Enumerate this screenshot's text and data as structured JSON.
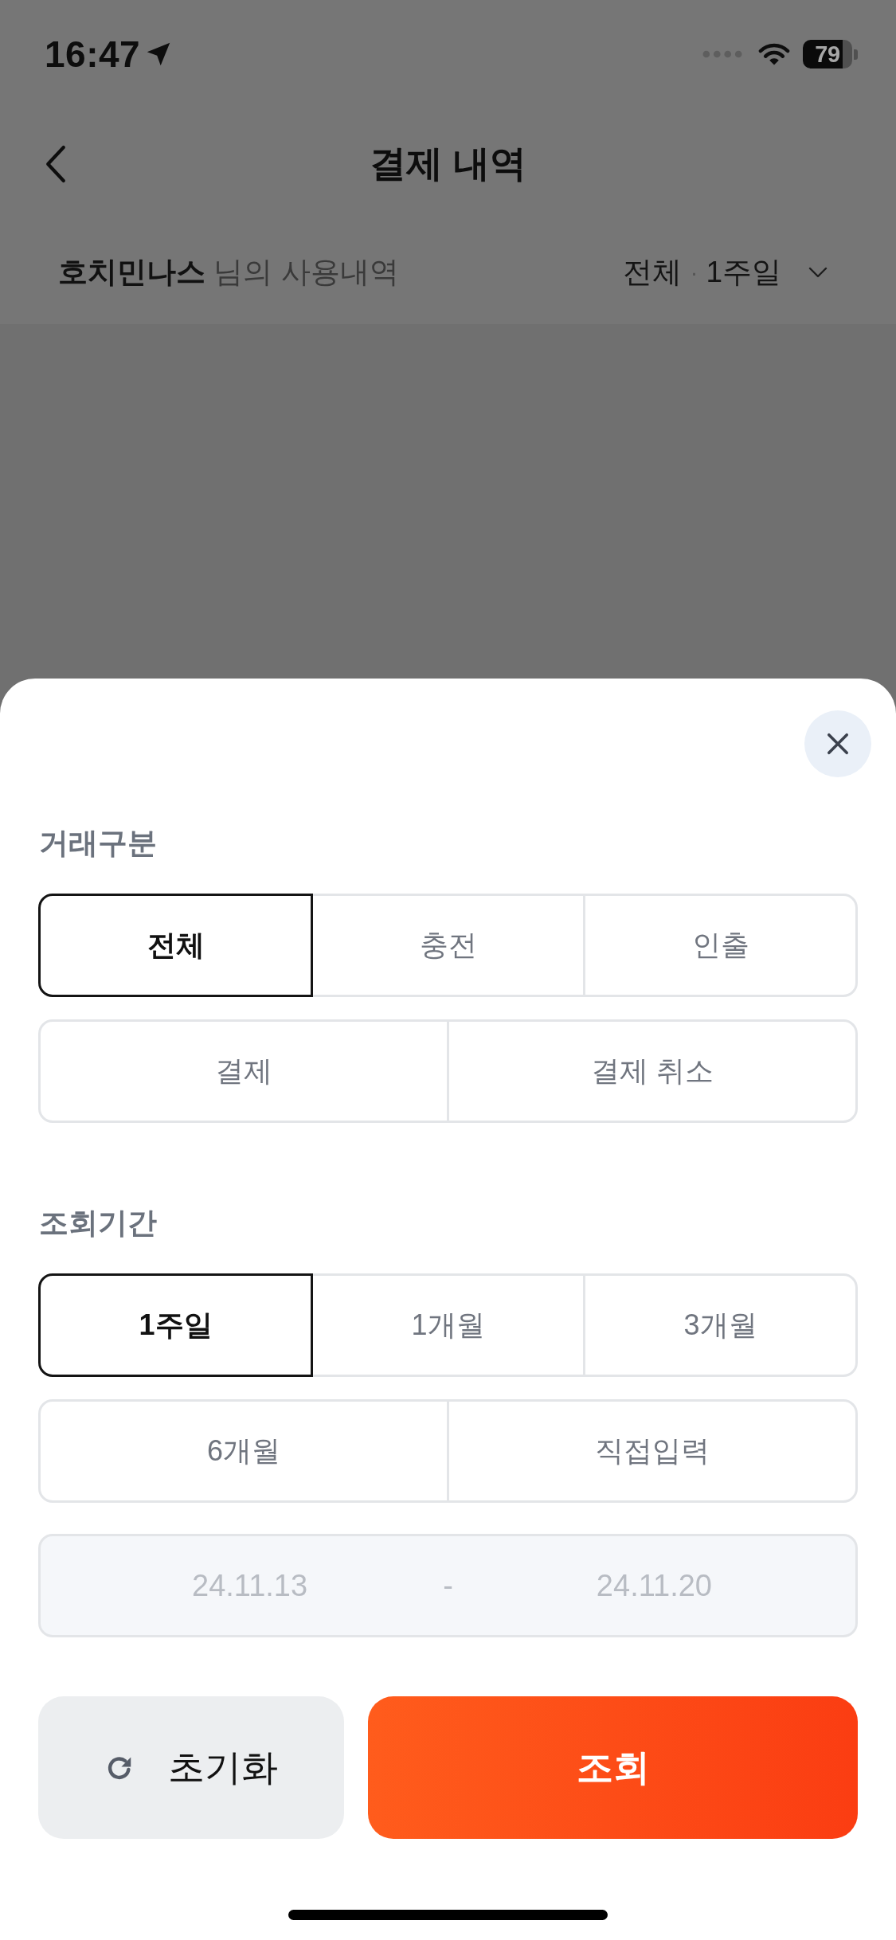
{
  "status_bar": {
    "time": "16:47",
    "battery": "79"
  },
  "header": {
    "title": "결제 내역"
  },
  "summary": {
    "text": "**호치민나스** 님의 사용내역",
    "filters": [
      "전체",
      "1주일"
    ],
    "separator": "·"
  },
  "filter_sheet": {
    "sections": [
      {
        "title": "거래구분",
        "rows": [
          {
            "options": [
              {
                "label": "전체",
                "selected": true
              },
              {
                "label": "충전",
                "selected": false
              },
              {
                "label": "인출",
                "selected": false
              }
            ]
          },
          {
            "options": [
              {
                "label": "결제",
                "selected": false
              },
              {
                "label": "결제 취소",
                "selected": false
              }
            ]
          }
        ]
      },
      {
        "title": "조회기간",
        "rows": [
          {
            "options": [
              {
                "label": "1주일",
                "selected": true
              },
              {
                "label": "1개월",
                "selected": false
              },
              {
                "label": "3개월",
                "selected": false
              }
            ]
          },
          {
            "options": [
              {
                "label": "6개월",
                "selected": false
              },
              {
                "label": "직접입력",
                "selected": false
              }
            ]
          }
        ],
        "date_range": {
          "start": "24.11.13",
          "separator": "-",
          "end": "24.11.20",
          "disabled": true
        }
      }
    ],
    "buttons": [
      {
        "kind": "reset",
        "label": "초기화"
      },
      {
        "kind": "submit",
        "label": "조회"
      }
    ]
  }
}
